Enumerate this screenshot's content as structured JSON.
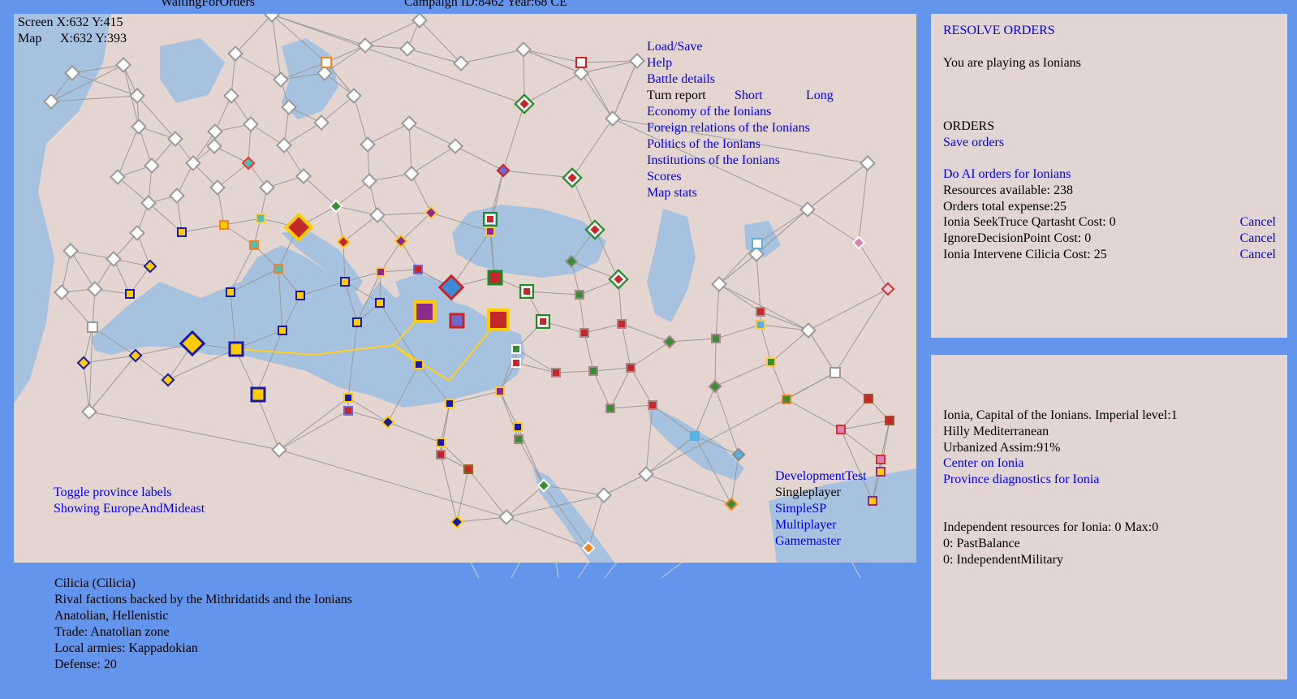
{
  "header": {
    "status": "WaitingForOrders",
    "campaign": "Campaign ID:8462  Year:68 CE"
  },
  "coords": {
    "screen": "Screen X:632 Y:415",
    "map_label": "Map",
    "map_value": "X:632 Y:393"
  },
  "menu": {
    "load_save": "Load/Save",
    "help": "Help",
    "battle_details": "Battle details",
    "turn_report": "Turn report",
    "short": "Short",
    "long": "Long",
    "economy": "Economy of the Ionians",
    "foreign": "Foreign relations of the Ionians",
    "politics": "Politics of the Ionians",
    "institutions": "Institutions of the Ionians",
    "scores": "Scores",
    "map_stats": "Map stats"
  },
  "map_links": {
    "toggle_labels": "Toggle province labels",
    "showing": "Showing EuropeAndMideast"
  },
  "mode": {
    "development_test": "DevelopmentTest",
    "singleplayer": "Singleplayer",
    "simple_sp": "SimpleSP",
    "multiplayer": "Multiplayer",
    "gamemaster": "Gamemaster"
  },
  "orders_panel": {
    "title": "RESOLVE ORDERS",
    "playing_as": "You are playing as Ionians",
    "orders_heading": "ORDERS",
    "save_orders": "Save orders",
    "ai_orders": "Do AI orders for Ionians",
    "resources": "Resources available: 238",
    "expense": "Orders total expense:25",
    "orders": [
      {
        "text": "Ionia SeekTruce Qartasht Cost: 0",
        "cancel": "Cancel"
      },
      {
        "text": "IgnoreDecisionPoint Cost: 0",
        "cancel": "Cancel"
      },
      {
        "text": "Ionia Intervene Cilicia Cost: 25",
        "cancel": "Cancel"
      }
    ]
  },
  "province_panel": {
    "capital": "Ionia, Capital of the Ionians. Imperial level:1",
    "terrain": "Hilly Mediterranean",
    "urban": "Urbanized Assim:91%",
    "center": "Center on Ionia",
    "diagnostics": "Province diagnostics for Ionia",
    "independent": "Independent resources for Ionia: 0 Max:0",
    "past_balance": "0: PastBalance",
    "indep_military": "0: IndependentMilitary"
  },
  "hover_info": {
    "name": "Cilicia (Cilicia)",
    "rival": "Rival factions backed by the Mithridatids and the Ionians",
    "culture": "Anatolian, Hellenistic",
    "trade": "Trade: Anatolian zone",
    "armies": "Local armies: Kappadokian",
    "defense": "Defense: 20"
  },
  "colors": {
    "background": "#6495ED",
    "panel": "#e3d5d3",
    "link": "#0000EE",
    "sea": "#a7c2de",
    "land": "#e5d5d0",
    "route": "#ffd21e"
  }
}
